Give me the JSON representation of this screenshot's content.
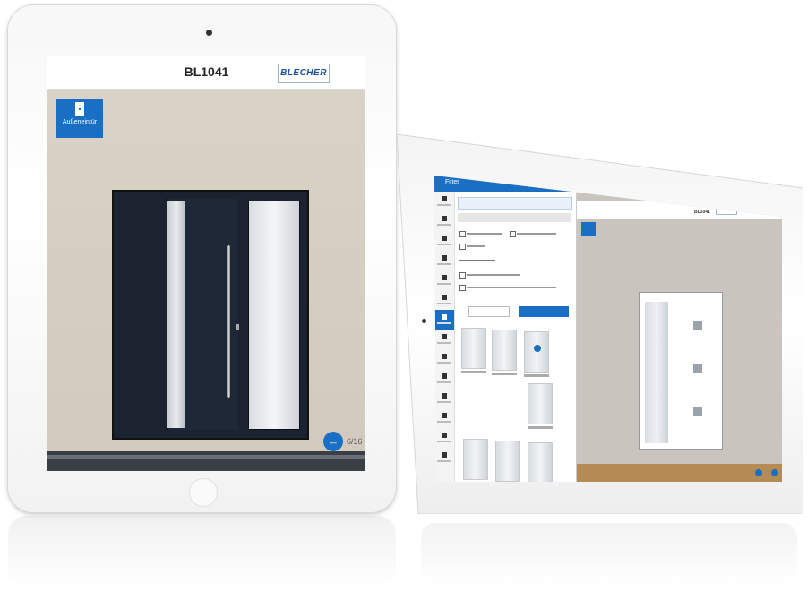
{
  "tablet_front": {
    "product_code": "BL1041",
    "brand": "BLECHER",
    "door_type_label": "Außeneintür",
    "page_counter": "6/16",
    "prev_icon": "arrow-left-icon"
  },
  "tablet_back": {
    "panel_title": "Filter",
    "product_code": "BL1041",
    "brand": "BLECHER"
  },
  "colors": {
    "accent": "#1a6fc4",
    "wall": "#d6cfc4",
    "door": "#1b2330"
  }
}
